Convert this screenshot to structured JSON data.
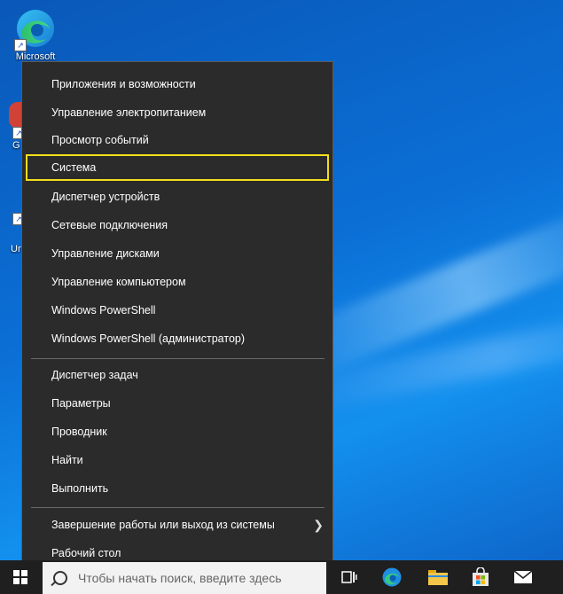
{
  "desktop": {
    "icons": [
      {
        "label": "Microsoft"
      },
      {
        "label": "G"
      },
      {
        "label": "Un"
      }
    ]
  },
  "menu": {
    "items_group1": [
      {
        "label": "Приложения и возможности"
      },
      {
        "label": "Управление электропитанием"
      },
      {
        "label": "Просмотр событий"
      },
      {
        "label": "Система"
      },
      {
        "label": "Диспетчер устройств"
      },
      {
        "label": "Сетевые подключения"
      },
      {
        "label": "Управление дисками"
      },
      {
        "label": "Управление компьютером"
      },
      {
        "label": "Windows PowerShell"
      },
      {
        "label": "Windows PowerShell (администратор)"
      }
    ],
    "items_group2": [
      {
        "label": "Диспетчер задач"
      },
      {
        "label": "Параметры"
      },
      {
        "label": "Проводник"
      },
      {
        "label": "Найти"
      },
      {
        "label": "Выполнить"
      }
    ],
    "items_group3": [
      {
        "label": "Завершение работы или выход из системы",
        "submenu_icon": "chevron-right-icon"
      },
      {
        "label": "Рабочий стол"
      }
    ],
    "selected_item": "Система",
    "highlight_color": "#f2de1b"
  },
  "taskbar": {
    "search_placeholder": "Чтобы начать поиск, введите здесь",
    "buttons": [
      "task-view-icon",
      "edge-icon",
      "file-explorer-icon",
      "store-icon",
      "mail-icon"
    ]
  }
}
